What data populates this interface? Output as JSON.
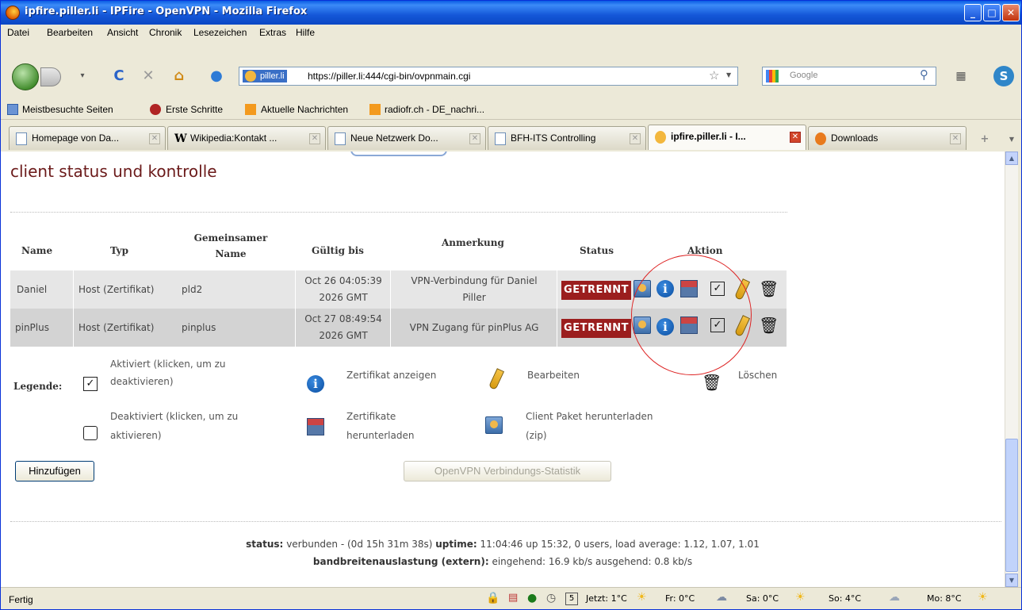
{
  "window": {
    "title": "ipfire.piller.li - IPFire - OpenVPN - Mozilla Firefox"
  },
  "menu": [
    "Datei",
    "Bearbeiten",
    "Ansicht",
    "Chronik",
    "Lesezeichen",
    "Extras",
    "Hilfe"
  ],
  "nav": {
    "site_label": "piller.li",
    "url": "https://piller.li:444/cgi-bin/ovpnmain.cgi",
    "search_placeholder": "Google"
  },
  "bookmarks": [
    "Meistbesuchte Seiten",
    "Erste Schritte",
    "Aktuelle Nachrichten",
    "radiofr.ch - DE_nachri..."
  ],
  "tabs": [
    "Homepage von Da...",
    "Wikipedia:Kontakt ...",
    "Neue Netzwerk Do...",
    "BFH-ITS Controlling",
    "ipfire.piller.li - I...",
    "Downloads"
  ],
  "page": {
    "heading": "client status und kontrolle",
    "columns": {
      "name": "Name",
      "typ": "Typ",
      "gemein_a": "Gemeinsamer",
      "gemein_b": "Name",
      "gueltig": "Gültig bis",
      "anmerkung": "Anmerkung",
      "status": "Status",
      "aktion": "Aktion"
    },
    "rows": [
      {
        "name": "Daniel",
        "typ": "Host (Zertifikat)",
        "cn": "pld2",
        "valid_a": "Oct 26 04:05:39",
        "valid_b": "2026 GMT",
        "note_a": "VPN-Verbindung für Daniel",
        "note_b": "Piller",
        "status": "GETRENNT"
      },
      {
        "name": "pinPlus",
        "typ": "Host (Zertifikat)",
        "cn": "pinplus",
        "valid_a": "Oct 27 08:49:54",
        "valid_b": "2026 GMT",
        "note_a": "VPN Zugang für pinPlus AG",
        "note_b": "",
        "status": "GETRENNT"
      }
    ],
    "legend": {
      "title": "Legende:",
      "activated_a": "Aktiviert (klicken, um zu",
      "activated_b": "deaktivieren)",
      "show_cert": "Zertifikat anzeigen",
      "edit": "Bearbeiten",
      "delete": "Löschen",
      "deactivated_a": "Deaktiviert (klicken, um zu",
      "deactivated_b": "aktivieren)",
      "download_a": "Zertifikate",
      "download_b": "herunterladen",
      "client_a": "Client Paket herunterladen",
      "client_b": "(zip)"
    },
    "buttons": {
      "add": "Hinzufügen",
      "stats": "OpenVPN Verbindungs-Statistik"
    },
    "footer": {
      "status_label": "status:",
      "status_value": "verbunden - (0d 15h 31m 38s)",
      "uptime_label": "uptime:",
      "uptime_value": "11:04:46 up 15:32, 0 users, load average: 1.12, 1.07, 1.01",
      "bw_label": "bandbreitenauslastung (extern):",
      "bw_value": "eingehend: 16.9 kb/s ausgehend: 0.8 kb/s"
    }
  },
  "statusbar": {
    "text": "Fertig",
    "weather": [
      "Jetzt: 1°C",
      "Fr: 0°C",
      "Sa: 0°C",
      "So: 4°C",
      "Mo: 8°C"
    ],
    "calendar_day": "5"
  },
  "colors": {
    "status_badge": "#9b1e1e",
    "heading": "#6b1a1a",
    "annotation_ring": "#dd2222"
  }
}
